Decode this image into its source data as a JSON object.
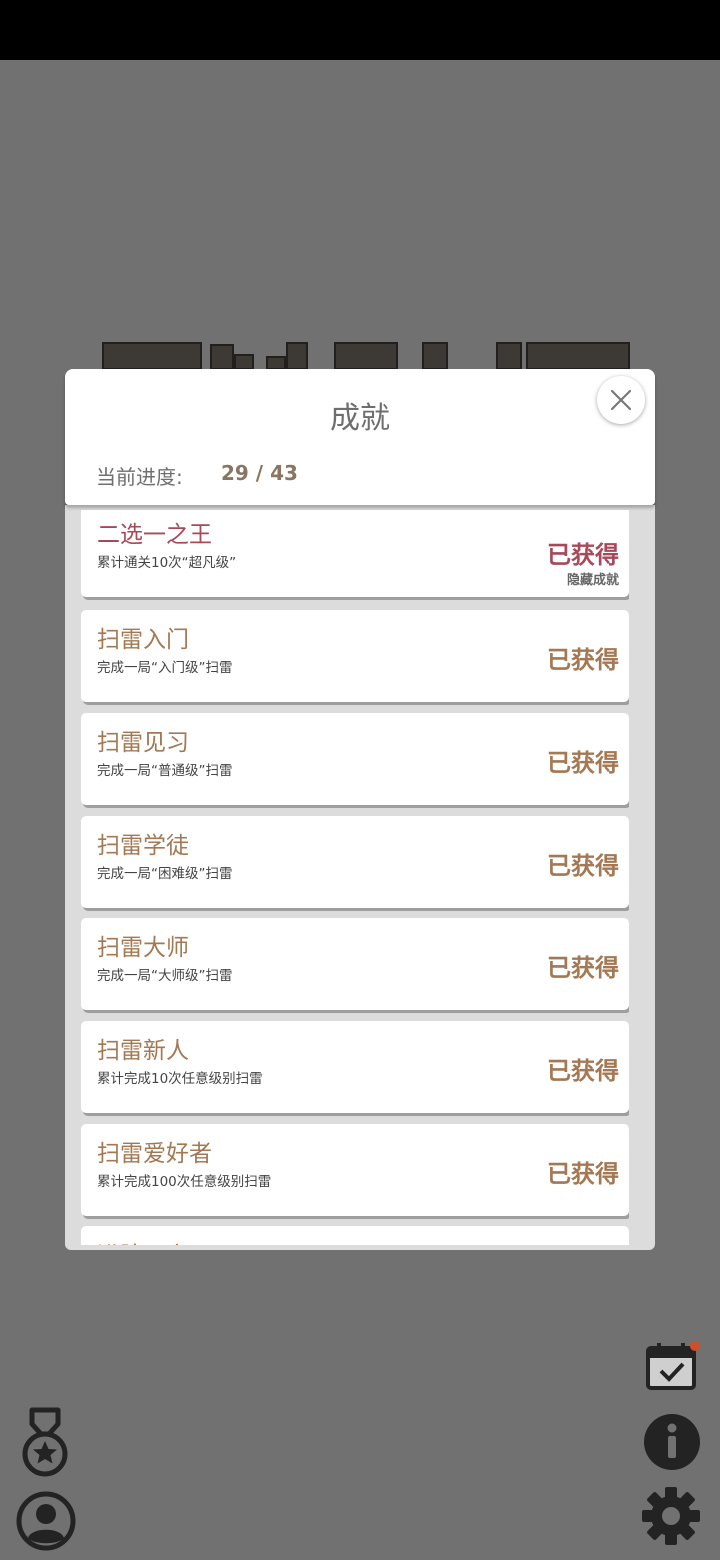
{
  "modal": {
    "title": "成就",
    "progress_label": "当前进度:",
    "progress_value": "29 / 43"
  },
  "achievements": [
    {
      "name": "二选一之王",
      "desc": "累计通关10次“超凡级”",
      "status": "已获得",
      "tag": "隐藏成就"
    },
    {
      "name": "扫雷入门",
      "desc": "完成一局“入门级”扫雷",
      "status": "已获得"
    },
    {
      "name": "扫雷见习",
      "desc": "完成一局“普通级”扫雷",
      "status": "已获得"
    },
    {
      "name": "扫雷学徒",
      "desc": "完成一局“困难级”扫雷",
      "status": "已获得"
    },
    {
      "name": "扫雷大师",
      "desc": "完成一局“大师级”扫雷",
      "status": "已获得"
    },
    {
      "name": "扫雷新人",
      "desc": "累计完成10次任意级别扫雷",
      "status": "已获得"
    },
    {
      "name": "扫雷爱好者",
      "desc": "累计完成100次任意级别扫雷",
      "status": "已获得"
    },
    {
      "name": "进阶玩家",
      "desc": "",
      "status": ""
    }
  ],
  "icons": {
    "close": "close-icon",
    "medal": "medal-icon",
    "profile": "profile-icon",
    "calendar": "calendar-check-icon",
    "info": "info-icon",
    "settings": "gear-icon"
  },
  "colors": {
    "accent": "#a37852",
    "hidden_accent": "#a8495a",
    "badge": "#d14e2b"
  }
}
